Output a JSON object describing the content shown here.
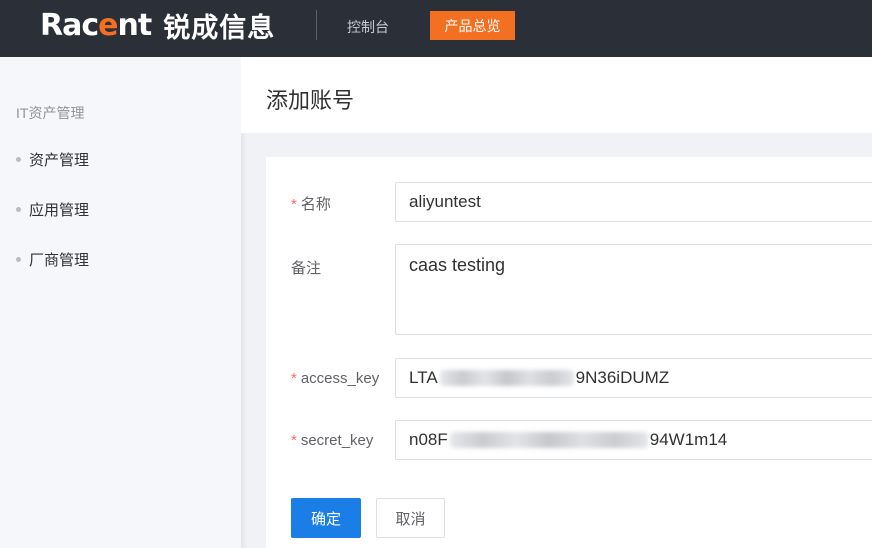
{
  "header": {
    "logo_word_prefix": "Rac",
    "logo_word_accent": "e",
    "logo_word_suffix": "nt",
    "logo_cn": "锐成信息",
    "nav_console": "控制台",
    "nav_overview": "产品总览",
    "accent_color": "#f36f21"
  },
  "sidebar": {
    "group_title": "IT资产管理",
    "items": [
      {
        "label": "资产管理"
      },
      {
        "label": "应用管理"
      },
      {
        "label": "厂商管理"
      }
    ]
  },
  "page": {
    "title": "添加账号"
  },
  "form": {
    "name": {
      "label": "名称",
      "required": true,
      "value": "aliyuntest"
    },
    "remark": {
      "label": "备注",
      "required": false,
      "value": "caas testing"
    },
    "access_key": {
      "label": "access_key",
      "required": true,
      "value_prefix": "LTA",
      "value_suffix": "9N36iDUMZ"
    },
    "secret_key": {
      "label": "secret_key",
      "required": true,
      "value_prefix": "n08F",
      "value_suffix": "94W1m14"
    }
  },
  "buttons": {
    "confirm": "确定",
    "cancel": "取消",
    "primary_color": "#1a7ee6"
  }
}
